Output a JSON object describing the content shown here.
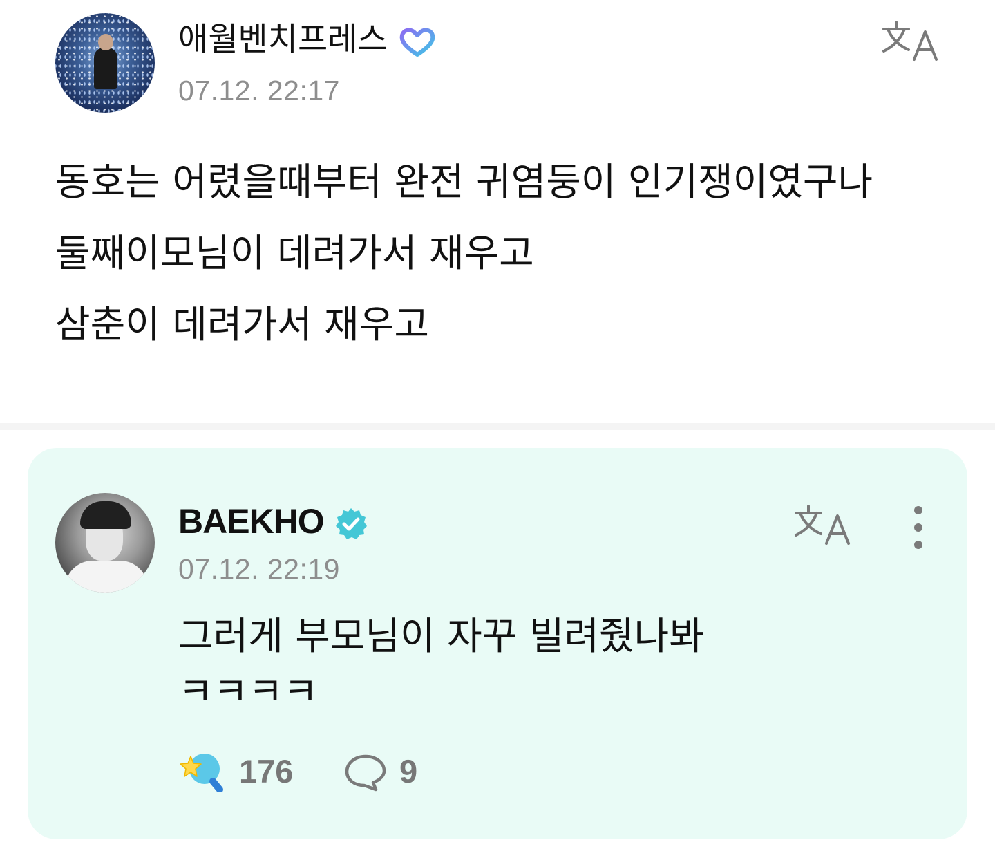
{
  "post": {
    "author": "애월벤치프레스",
    "author_badge": "membership-heart-icon",
    "timestamp": "07.12. 22:17",
    "translate_icon": "translate-icon",
    "body_lines": [
      "동호는 어렸을때부터 완전 귀염둥이 인기쟁이였구나",
      "둘째이모님이 데려가서 재우고",
      "삼춘이 데려가서 재우고"
    ]
  },
  "comment": {
    "author": "BAEKHO",
    "author_badge": "verified-badge-icon",
    "timestamp": "07.12. 22:19",
    "translate_icon": "translate-icon",
    "more_icon": "more-vertical-icon",
    "body_lines": [
      "그러게 부모님이 자꾸 빌려줬나봐",
      "ㅋㅋㅋㅋ"
    ],
    "reactions": {
      "icon": "weverse-reaction-icon",
      "count": "176"
    },
    "replies": {
      "icon": "comment-bubble-icon",
      "count": "9"
    }
  },
  "colors": {
    "card_bg": "#e9fbf6",
    "verified": "#44c7d6",
    "muted": "#8e8e8e"
  }
}
